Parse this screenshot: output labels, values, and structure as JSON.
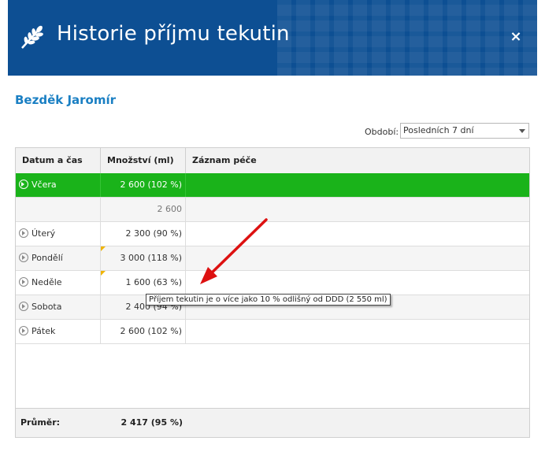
{
  "header": {
    "title": "Historie příjmu tekutin",
    "close_label": "×",
    "logo_icon": "wheat-icon",
    "color": "#0d4f93"
  },
  "patient": {
    "name": "Bezděk Jaromír",
    "color": "#1a7fc3"
  },
  "filter": {
    "label": "Období:",
    "selected": "Posledních 7 dní"
  },
  "table": {
    "columns": [
      "Datum a čas",
      "Množství (ml)",
      "Záznam péče"
    ],
    "rows": [
      {
        "day": "Včera",
        "amount": "2 600 (102 %)",
        "record": "",
        "selected": true
      },
      {
        "day": "",
        "amount": "2 600",
        "record": "",
        "sub": true
      },
      {
        "day": "Úterý",
        "amount": "2 300 (90 %)",
        "record": ""
      },
      {
        "day": "Pondělí",
        "amount": "3 000 (118 %)",
        "record": "",
        "flag": true
      },
      {
        "day": "Neděle",
        "amount": "1 600 (63 %)",
        "record": "",
        "flag": true
      },
      {
        "day": "Sobota",
        "amount": "2 400 (94 %)",
        "record": ""
      },
      {
        "day": "Pátek",
        "amount": "2 600 (102 %)",
        "record": ""
      }
    ],
    "footer": {
      "label": "Průměr:",
      "value": "2 417 (95 %)"
    },
    "selected_color": "#1ab31a",
    "flag_color": "#f0b400"
  },
  "tooltip": {
    "text": "Příjem tekutin je o více jako 10 % odlišný od DDD (2 550 ml)"
  }
}
